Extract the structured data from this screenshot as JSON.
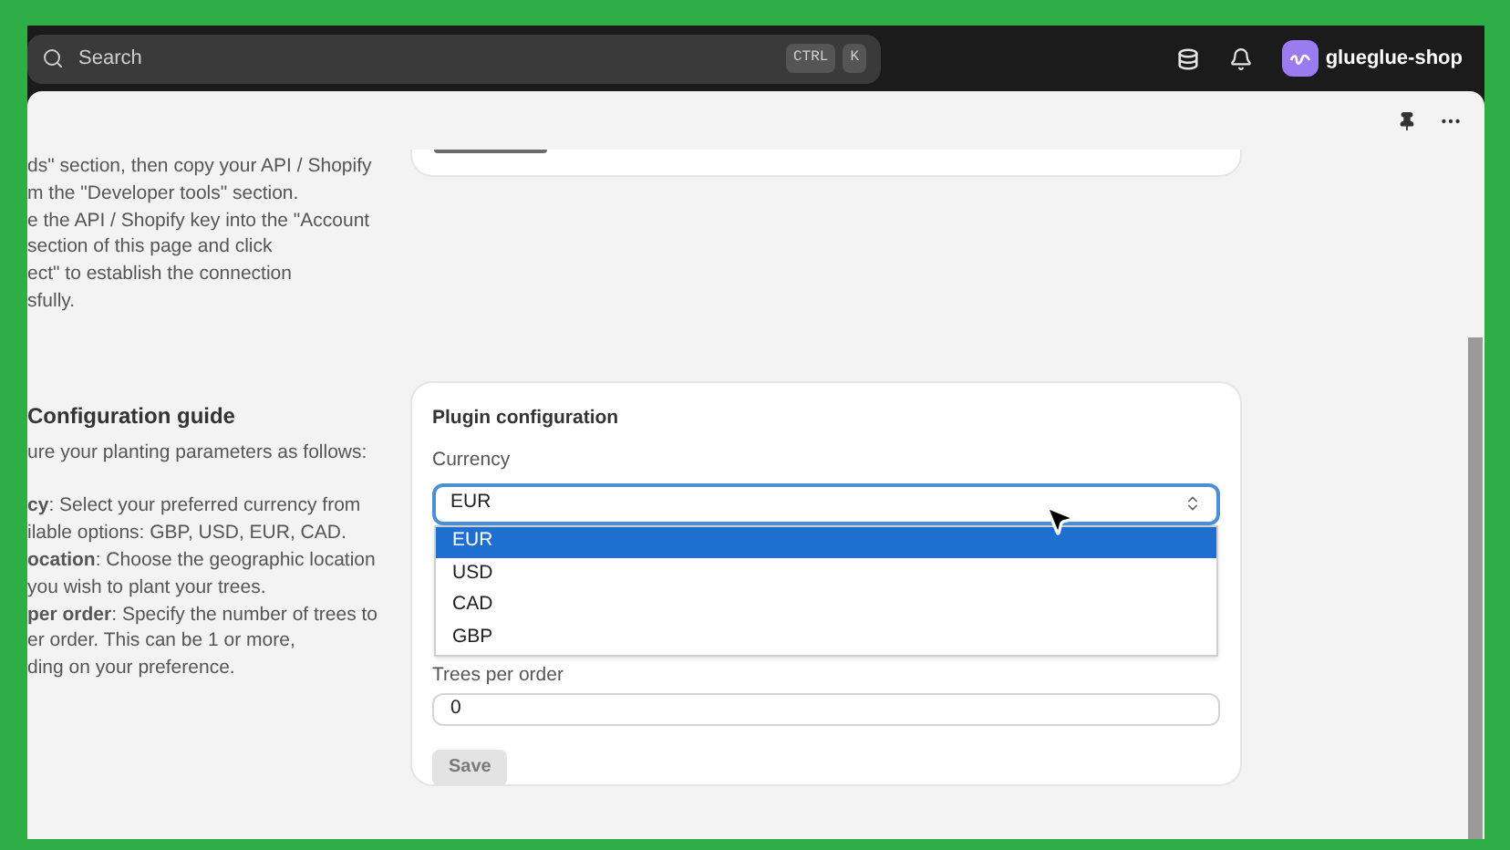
{
  "topbar": {
    "search": {
      "placeholder": "Search"
    },
    "shortcut_keys": [
      "CTRL",
      "K"
    ],
    "shop_name": "glueglue-shop"
  },
  "instructions": {
    "lines": [
      "ds\" section, then copy your API / Shopify",
      "m the \"Developer tools\" section.",
      "e the API / Shopify key into the \"Account",
      "section of this page and click",
      "ect\" to establish the connection",
      "sfully."
    ]
  },
  "guide": {
    "title": "Configuration guide",
    "intro": "ure your planting parameters as follows:",
    "lines": [
      "**cy**: Select your preferred currency from",
      "ilable options: GBP, USD, EUR, CAD.",
      "**ocation**: Choose the geographic location",
      "you wish to plant your trees.",
      "**per order**: Specify the number of trees to",
      "er order. This can be 1 or more,",
      "ding on your preference."
    ]
  },
  "plugin_configuration": {
    "title": "Plugin configuration",
    "currency_label": "Currency",
    "currency_value": "EUR",
    "dropdown_open": true,
    "options": [
      {
        "label": "EUR",
        "selected": true
      },
      {
        "label": "USD",
        "selected": false
      },
      {
        "label": "CAD",
        "selected": false
      },
      {
        "label": "GBP",
        "selected": false
      }
    ],
    "trees_label": "Trees per order",
    "trees_value": "0",
    "save_button": {
      "label": "Save",
      "disabled": true
    }
  }
}
